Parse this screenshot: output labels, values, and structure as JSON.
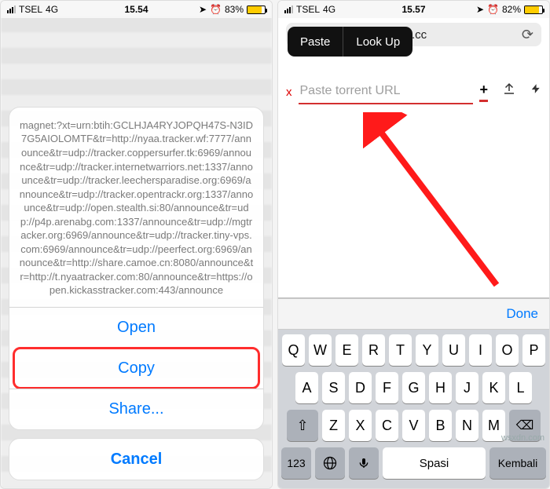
{
  "left": {
    "status": {
      "carrier": "TSEL",
      "network": "4G",
      "time": "15.54",
      "loc_icon": "location-icon",
      "alarm_icon": "alarm-icon",
      "battery_pct": "83%"
    },
    "sheet": {
      "magnet_text": "magnet:?xt=urn:btih:GCLHJA4RYJOPQH47S-N3ID7G5AIOLOMTF&tr=http://nyaa.tracker.wf:7777/announce&tr=udp://tracker.coppersurfer.tk:6969/announce&tr=udp://tracker.internetwarriors.net:1337/announce&tr=udp://tracker.leechersparadise.org:6969/announce&tr=udp://tracker.opentrackr.org:1337/announce&tr=udp://open.stealth.si:80/announce&tr=udp://p4p.arenabg.com:1337/announce&tr=udp://mgtracker.org:6969/announce&tr=udp://tracker.tiny-vps.com:6969/announce&tr=udp://peerfect.org:6969/announce&tr=http://share.camoe.cn:8080/announce&tr=http://t.nyaatracker.com:80/announce&tr=https://open.kickasstracker.com:443/announce",
      "open": "Open",
      "copy": "Copy",
      "share": "Share...",
      "cancel": "Cancel"
    }
  },
  "right": {
    "status": {
      "carrier": "TSEL",
      "network": "4G",
      "time": "15.57",
      "battery_pct": "82%"
    },
    "url_domain": "eedr.cc",
    "ctx": {
      "paste": "Paste",
      "lookup": "Look Up"
    },
    "input": {
      "placeholder": "Paste torrent URL",
      "clear": "x"
    },
    "icons": {
      "add": "+",
      "upload": "⬆",
      "bolt": "⚡"
    },
    "done": "Done",
    "keyboard": {
      "row1": [
        "Q",
        "W",
        "E",
        "R",
        "T",
        "Y",
        "U",
        "I",
        "O",
        "P"
      ],
      "row2": [
        "A",
        "S",
        "D",
        "F",
        "G",
        "H",
        "J",
        "K",
        "L"
      ],
      "row3_shift": "⇧",
      "row3": [
        "Z",
        "X",
        "C",
        "V",
        "B",
        "N",
        "M"
      ],
      "row3_del": "⌫",
      "num": "123",
      "globe": "🌐",
      "mic": "🎤",
      "space": "Spasi",
      "return": "Kembali"
    }
  },
  "watermark": "wsxdn.com"
}
